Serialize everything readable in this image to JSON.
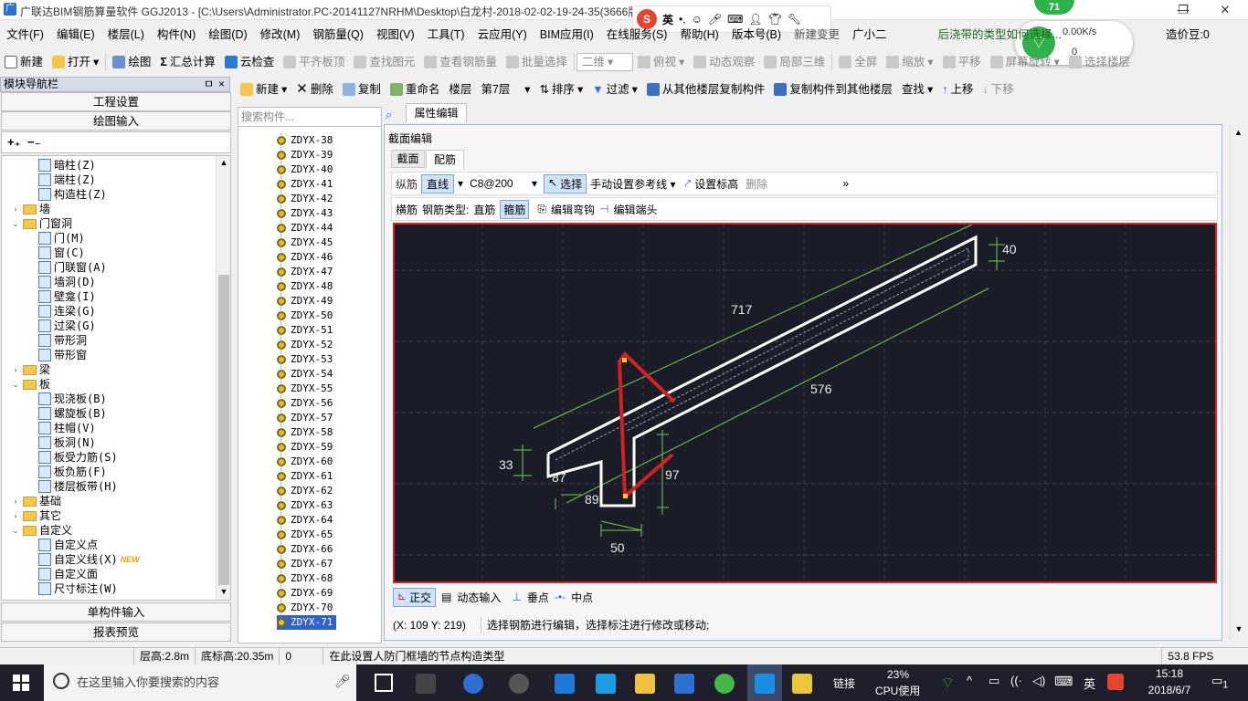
{
  "window": {
    "title": "广联达BIM钢筋算量软件 GGJ2013 - [C:\\Users\\Administrator.PC-20141127NRHM\\Desktop\\白龙村-2018-02-02-19-24-35(3666版).GGJ12]",
    "btn_min": "—",
    "btn_max": "❐",
    "btn_close": "✕"
  },
  "menu": {
    "items": [
      "文件(F)",
      "编辑(E)",
      "楼层(L)",
      "构件(N)",
      "绘图(D)",
      "修改(M)",
      "钢筋量(Q)",
      "视图(V)",
      "工具(T)",
      "云应用(Y)",
      "BIM应用(I)",
      "在线服务(S)",
      "帮助(H)",
      "版本号(B)",
      "新建变更",
      "广小二"
    ],
    "hint": "后浇带的类型如何选择...",
    "beans": "造价豆:0"
  },
  "toolbar": {
    "items": [
      "新建",
      "打开",
      "绘图",
      "汇总计算",
      "云检查",
      "平齐板顶",
      "查找图元",
      "查看钢筋量",
      "批量选择",
      "二维",
      "俯视",
      "动态观察",
      "局部三维",
      "全屏",
      "缩放",
      "平移",
      "屏幕旋转",
      "选择楼层"
    ]
  },
  "nav": {
    "header": "模块导航栏",
    "pin": "ㅁ",
    "close": "×",
    "btn_project": "工程设置",
    "btn_draw": "绘图输入",
    "btn_single": "单构件输入",
    "btn_report": "报表预览",
    "tree": [
      {
        "label": "暗柱(Z)",
        "level": 2,
        "type": "item"
      },
      {
        "label": "端柱(Z)",
        "level": 2,
        "type": "item"
      },
      {
        "label": "构造柱(Z)",
        "level": 2,
        "type": "item"
      },
      {
        "label": "墙",
        "level": 0,
        "type": "folder",
        "toggle": "+"
      },
      {
        "label": "门窗洞",
        "level": 0,
        "type": "folder",
        "toggle": "−"
      },
      {
        "label": "门(M)",
        "level": 2,
        "type": "item"
      },
      {
        "label": "窗(C)",
        "level": 2,
        "type": "item"
      },
      {
        "label": "门联窗(A)",
        "level": 2,
        "type": "item"
      },
      {
        "label": "墙洞(D)",
        "level": 2,
        "type": "item"
      },
      {
        "label": "壁龛(I)",
        "level": 2,
        "type": "item"
      },
      {
        "label": "连梁(G)",
        "level": 2,
        "type": "item"
      },
      {
        "label": "过梁(G)",
        "level": 2,
        "type": "item"
      },
      {
        "label": "带形洞",
        "level": 2,
        "type": "item"
      },
      {
        "label": "带形窗",
        "level": 2,
        "type": "item"
      },
      {
        "label": "梁",
        "level": 0,
        "type": "folder",
        "toggle": "+"
      },
      {
        "label": "板",
        "level": 0,
        "type": "folder",
        "toggle": "−"
      },
      {
        "label": "现浇板(B)",
        "level": 2,
        "type": "item"
      },
      {
        "label": "螺旋板(B)",
        "level": 2,
        "type": "item"
      },
      {
        "label": "柱帽(V)",
        "level": 2,
        "type": "item"
      },
      {
        "label": "板洞(N)",
        "level": 2,
        "type": "item"
      },
      {
        "label": "板受力筋(S)",
        "level": 2,
        "type": "item"
      },
      {
        "label": "板负筋(F)",
        "level": 2,
        "type": "item"
      },
      {
        "label": "楼层板带(H)",
        "level": 2,
        "type": "item"
      },
      {
        "label": "基础",
        "level": 0,
        "type": "folder",
        "toggle": "+"
      },
      {
        "label": "其它",
        "level": 0,
        "type": "folder",
        "toggle": "+"
      },
      {
        "label": "自定义",
        "level": 0,
        "type": "folder",
        "toggle": "−"
      },
      {
        "label": "自定义点",
        "level": 2,
        "type": "item"
      },
      {
        "label": "自定义线(X)",
        "level": 2,
        "type": "item",
        "badge": "NEW"
      },
      {
        "label": "自定义面",
        "level": 2,
        "type": "item"
      },
      {
        "label": "尺寸标注(W)",
        "level": 2,
        "type": "item"
      }
    ]
  },
  "components": {
    "toolbar": [
      "新建",
      "删除",
      "复制",
      "重命名",
      "楼层",
      "第7层",
      "排序",
      "过滤",
      "从其他楼层复制构件",
      "复制构件到其他楼层",
      "查找",
      "上移",
      "下移"
    ],
    "search_placeholder": "搜索构件...",
    "items": [
      "ZDYX-38",
      "ZDYX-39",
      "ZDYX-40",
      "ZDYX-41",
      "ZDYX-42",
      "ZDYX-43",
      "ZDYX-44",
      "ZDYX-45",
      "ZDYX-46",
      "ZDYX-47",
      "ZDYX-48",
      "ZDYX-49",
      "ZDYX-50",
      "ZDYX-51",
      "ZDYX-52",
      "ZDYX-53",
      "ZDYX-54",
      "ZDYX-55",
      "ZDYX-56",
      "ZDYX-57",
      "ZDYX-58",
      "ZDYX-59",
      "ZDYX-60",
      "ZDYX-61",
      "ZDYX-62",
      "ZDYX-63",
      "ZDYX-64",
      "ZDYX-65",
      "ZDYX-66",
      "ZDYX-67",
      "ZDYX-68",
      "ZDYX-69",
      "ZDYX-70",
      "ZDYX-71"
    ],
    "selected": "ZDYX-71"
  },
  "editor": {
    "attr_tab": "属性编辑",
    "section_header": "截面编辑",
    "tab_section": "截面",
    "tab_rebar": "配筋",
    "row1": {
      "label": "纵筋",
      "mode": "直线",
      "spec": "C8@200",
      "select": "选择",
      "manual": "手动设置参考线",
      "set_height": "设置标高",
      "delete": "删除"
    },
    "row2": {
      "label": "横筋",
      "type_label": "钢筋类型:",
      "straight": "直筋",
      "stirrup": "箍筋",
      "edit_hook": "编辑弯钩",
      "edit_end": "编辑端头"
    },
    "dims": {
      "d40": "40",
      "d717": "717",
      "d576": "576",
      "d33": "33",
      "d87": "87",
      "d97": "97",
      "d89": "89",
      "d50": "50"
    },
    "snap": {
      "ortho": "正交",
      "dynamic": "动态输入",
      "perp": "垂点",
      "mid": "中点"
    },
    "coords": "(X: 109 Y: 219)",
    "hint": "选择钢筋进行编辑，选择标注进行修改或移动;"
  },
  "status": {
    "floor_h": "层高:2.8m",
    "base_h": "底标高:20.35m",
    "zero": "0",
    "msg": "在此设置人防门框墙的节点构造类型",
    "fps": "53.8 FPS"
  },
  "taskbar": {
    "search": "在这里输入你要搜索的内容",
    "link": "链接",
    "cpu": "23%",
    "cpu_label": "CPU使用",
    "ime": "英",
    "time": "15:18",
    "date": "2018/6/7",
    "notif": "1"
  },
  "net": {
    "badge": "71",
    "speed": "0.00K/s",
    "count": "0"
  },
  "sogou": {
    "ime": "英"
  }
}
